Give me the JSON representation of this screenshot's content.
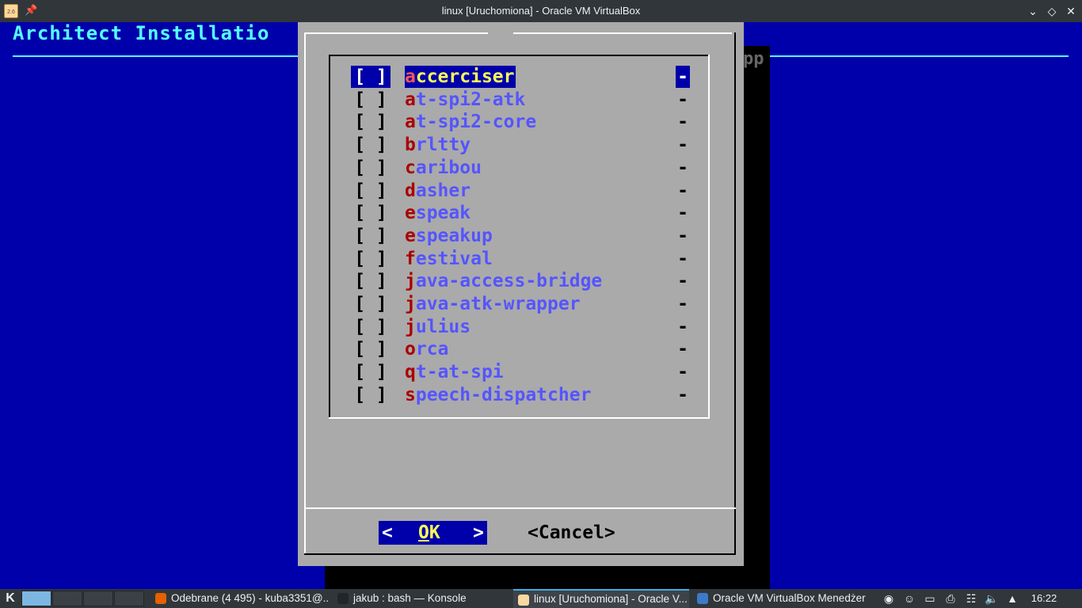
{
  "window": {
    "title": "linux [Uruchomiona] - Oracle VM VirtualBox",
    "app_icon_text": "2.6",
    "icons": [
      "virtualbox-icon",
      "pin-icon",
      "minimize-icon",
      "maximize-icon",
      "close-icon"
    ]
  },
  "vm": {
    "backtitle": "Architect Installatio",
    "shadow_text": "pp",
    "dialog": {
      "items": [
        {
          "hotkey": "a",
          "rest": "ccerciser",
          "check": "[ ]",
          "dash": "-",
          "selected": true
        },
        {
          "hotkey": "a",
          "rest": "t-spi2-atk",
          "check": "[ ]",
          "dash": "-"
        },
        {
          "hotkey": "a",
          "rest": "t-spi2-core",
          "check": "[ ]",
          "dash": "-"
        },
        {
          "hotkey": "b",
          "rest": "rltty",
          "check": "[ ]",
          "dash": "-"
        },
        {
          "hotkey": "c",
          "rest": "aribou",
          "check": "[ ]",
          "dash": "-"
        },
        {
          "hotkey": "d",
          "rest": "asher",
          "check": "[ ]",
          "dash": "-"
        },
        {
          "hotkey": "e",
          "rest": "speak",
          "check": "[ ]",
          "dash": "-"
        },
        {
          "hotkey": "e",
          "rest": "speakup",
          "check": "[ ]",
          "dash": "-"
        },
        {
          "hotkey": "f",
          "rest": "estival",
          "check": "[ ]",
          "dash": "-"
        },
        {
          "hotkey": "j",
          "rest": "ava-access-bridge",
          "check": "[ ]",
          "dash": "-"
        },
        {
          "hotkey": "j",
          "rest": "ava-atk-wrapper",
          "check": "[ ]",
          "dash": "-"
        },
        {
          "hotkey": "j",
          "rest": "ulius",
          "check": "[ ]",
          "dash": "-"
        },
        {
          "hotkey": "o",
          "rest": "rca",
          "check": "[ ]",
          "dash": "-"
        },
        {
          "hotkey": "q",
          "rest": "t-at-spi",
          "check": "[ ]",
          "dash": "-"
        },
        {
          "hotkey": "s",
          "rest": "peech-dispatcher",
          "check": "[ ]",
          "dash": "-"
        }
      ],
      "ok": {
        "lt": "<",
        "gt": ">",
        "hot": "O",
        "rest": "K"
      },
      "cancel": "<Cancel>"
    }
  },
  "taskbar": {
    "launcher_icon": "kde-launcher-icon",
    "tasks": [
      {
        "label": "Odebrane (4 495) - kuba3351@...",
        "icon": "firefox-icon",
        "color": "#e66000"
      },
      {
        "label": "jakub : bash — Konsole",
        "icon": "konsole-icon",
        "color": "#232629"
      },
      {
        "label": "linux [Uruchomiona] - Oracle V...",
        "icon": "virtualbox-vm-icon",
        "color": "#f7d9a0",
        "active": true
      },
      {
        "label": "Oracle VM VirtualBox Menedżer",
        "icon": "virtualbox-manager-icon",
        "color": "#3d7ac7"
      }
    ],
    "tray_icons": [
      "wifi-icon",
      "user-icon",
      "battery-icon",
      "printer-icon",
      "clipboard-icon",
      "volume-icon",
      "expand-tray-icon"
    ],
    "clock": "16:22"
  },
  "colors": {
    "vm_background": "#0000aa",
    "dialog_background": "#aaaaaa",
    "item_text": "#5555ff",
    "hotkey": "#aa0000",
    "highlight_text": "#ffff55",
    "backtitle": "#55ffff"
  }
}
